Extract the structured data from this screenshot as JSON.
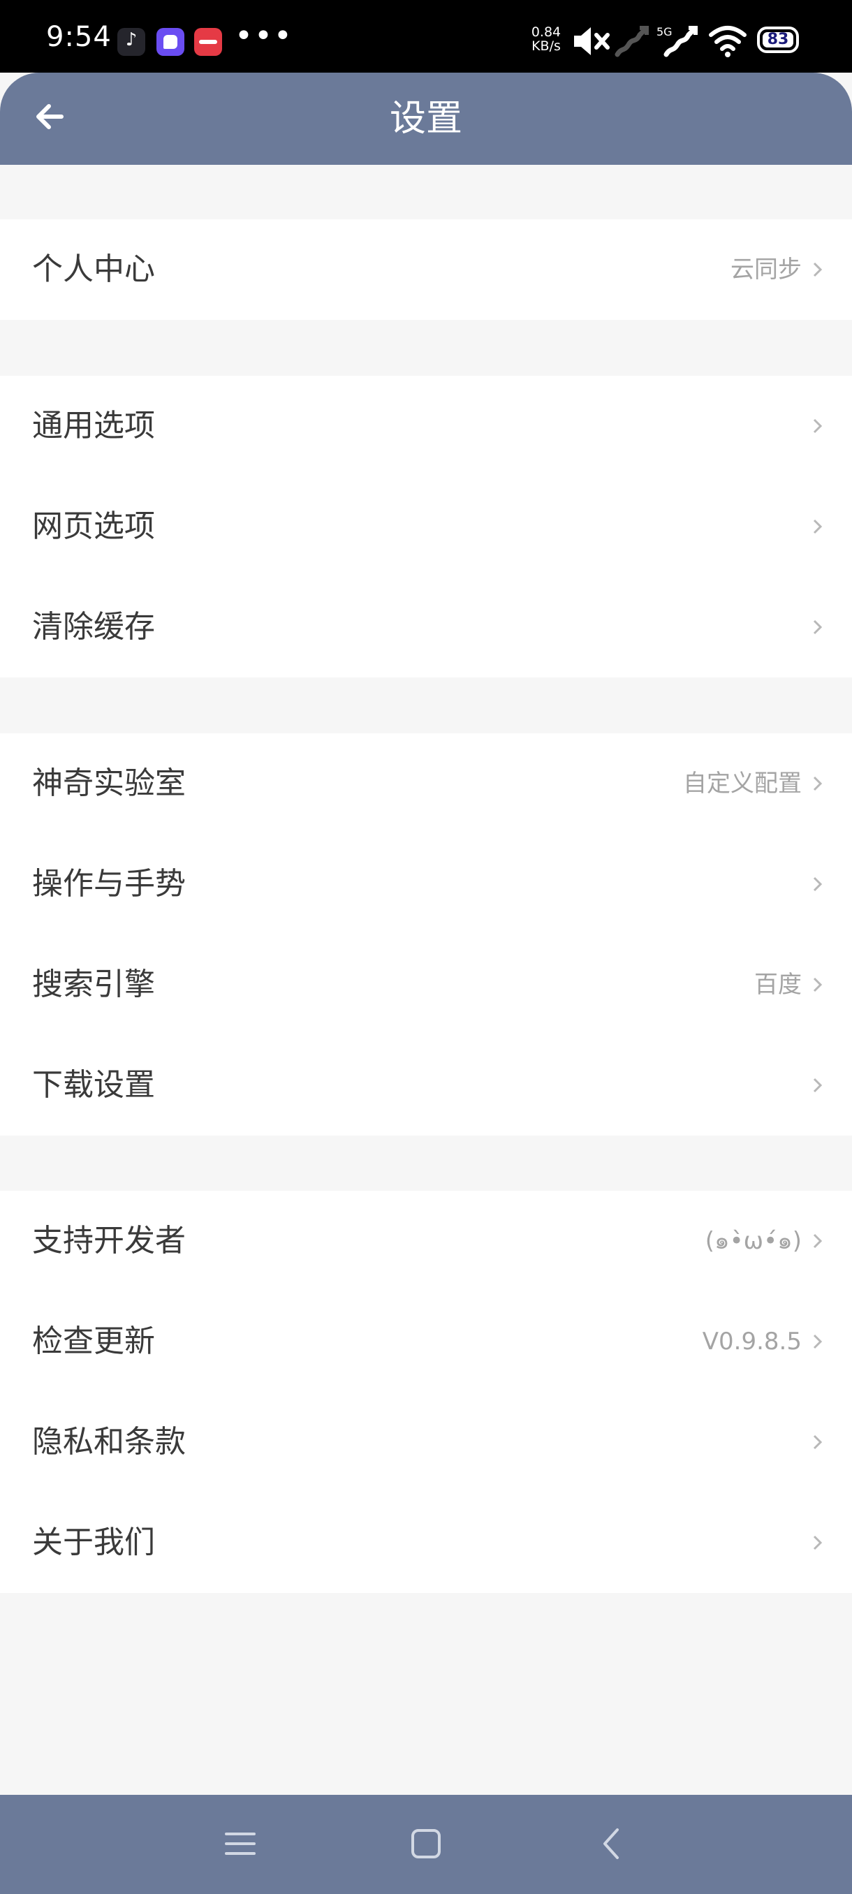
{
  "status_bar": {
    "time": "9:54",
    "net_speed_value": "0.84",
    "net_speed_unit": "KB/s",
    "network_label": "5G",
    "battery": "83",
    "more": "•••"
  },
  "header": {
    "title": "设置"
  },
  "groups": [
    {
      "items": [
        {
          "label": "个人中心",
          "value": "云同步"
        }
      ]
    },
    {
      "items": [
        {
          "label": "通用选项",
          "value": ""
        },
        {
          "label": "网页选项",
          "value": ""
        },
        {
          "label": "清除缓存",
          "value": ""
        }
      ]
    },
    {
      "items": [
        {
          "label": "神奇实验室",
          "value": "自定义配置"
        },
        {
          "label": "操作与手势",
          "value": ""
        },
        {
          "label": "搜索引擎",
          "value": "百度"
        },
        {
          "label": "下载设置",
          "value": ""
        }
      ]
    },
    {
      "items": [
        {
          "label": "支持开发者",
          "value": "(๑•̀ω•́๑)"
        },
        {
          "label": "检查更新",
          "value": "V0.9.8.5"
        },
        {
          "label": "隐私和条款",
          "value": ""
        },
        {
          "label": "关于我们",
          "value": ""
        }
      ]
    }
  ],
  "colors": {
    "header_bg": "#6b7a99",
    "page_bg": "#f6f6f6",
    "label": "#3a3a3a",
    "value": "#a4a4a4"
  }
}
